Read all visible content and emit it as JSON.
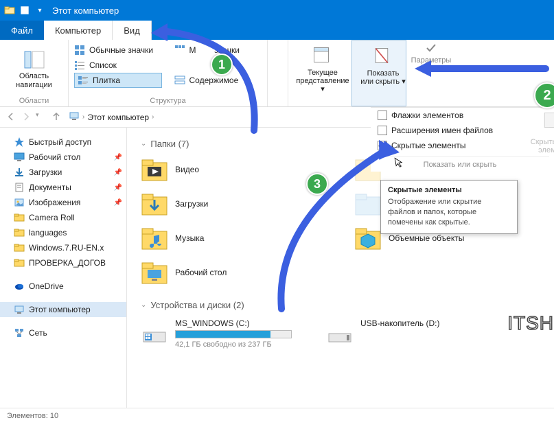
{
  "titlebar": {
    "title": "Этот компьютер"
  },
  "tabs": {
    "file": "Файл",
    "computer": "Компьютер",
    "view": "Вид"
  },
  "ribbon": {
    "nav_pane": {
      "label": "Область навигации",
      "group": "Области"
    },
    "layout": {
      "normal_icons": "Обычные значки",
      "m_icons": "М",
      "icons_suffix": "значки",
      "list": "Список",
      "tile": "Плитка",
      "content": "Содержимое",
      "group": "Структура"
    },
    "current_view": {
      "label_top": "Текущее",
      "label_bottom": "представление"
    },
    "show_hide": {
      "label_top": "Показать",
      "label_bottom": "или скрыть"
    },
    "params": "Параметры"
  },
  "show_hide_panel": {
    "item_checkboxes": "Флажки элементов",
    "file_ext": "Расширения имен файлов",
    "hidden_items": "Скрытые элементы",
    "group": "Показать или скрыть",
    "hide_selected_top": "Скрыть выб",
    "hide_selected_bottom": "элемен"
  },
  "address": {
    "crumb": "Этот компьютер"
  },
  "sidebar": {
    "quick": "Быстрый доступ",
    "desktop": "Рабочий стол",
    "downloads": "Загрузки",
    "documents": "Документы",
    "pictures": "Изображения",
    "camera": "Camera Roll",
    "languages": "languages",
    "win7": "Windows.7.RU-EN.x",
    "proverka": "ПРОВЕРКА_ДОГОВ",
    "onedrive": "OneDrive",
    "thispc": "Этот компьютер",
    "network": "Сеть"
  },
  "content": {
    "folders_header": "Папки (7)",
    "folders": {
      "video": "Видео",
      "downloads": "Загрузки",
      "music": "Музыка",
      "desktop": "Рабочий стол",
      "objects3d": "Объемные объекты"
    },
    "drives_header": "Устройства и диски (2)",
    "drive_c": {
      "name": "MS_WINDOWS (C:)",
      "free": "42,1 ГБ свободно из 237 ГБ"
    },
    "drive_d": {
      "name": "USB-накопитель (D:)"
    }
  },
  "statusbar": {
    "text": "Элементов: 10"
  },
  "tooltip": {
    "title": "Скрытые элементы",
    "body": "Отображение или скрытие файлов и папок, которые помечены как скрытые."
  },
  "badges": {
    "b1": "1",
    "b2": "2",
    "b3": "3"
  },
  "watermark": "ITSH"
}
